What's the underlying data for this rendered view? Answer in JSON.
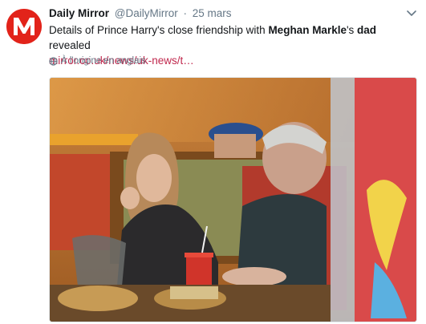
{
  "tweet": {
    "author_name": "Daily Mirror",
    "handle": "@DailyMirror",
    "separator": "·",
    "date": "25 mars",
    "text_part1": "Details of Prince Harry's close friendship with ",
    "text_bold1": "Meghan Markle",
    "text_part2": "'s ",
    "text_bold2": "dad",
    "text_part3": " revealed",
    "link": "mirror.co.uk/news/uk-news/t…",
    "translate_label": "À l'origine en anglais"
  },
  "icons": {
    "avatar": "daily-mirror-logo-icon",
    "more": "chevron-down-icon",
    "translate": "globe-icon"
  },
  "colors": {
    "brand": "#e2231a",
    "link": "#c0284d",
    "muted": "#657786"
  },
  "media": {
    "type": "photo"
  }
}
